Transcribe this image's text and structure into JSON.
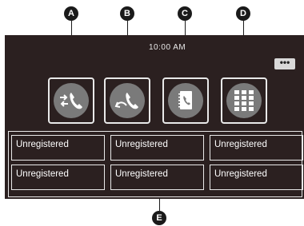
{
  "callouts": {
    "a": "A",
    "b": "B",
    "c": "C",
    "d": "D",
    "e": "E"
  },
  "status": {
    "time": "10:00 AM"
  },
  "more_button": {
    "label": "•••"
  },
  "icons": [
    "call-transfer-icon",
    "call-forward-icon",
    "phonebook-icon",
    "keypad-icon"
  ],
  "slots": [
    {
      "label": "Unregistered"
    },
    {
      "label": "Unregistered"
    },
    {
      "label": "Unregistered"
    },
    {
      "label": "Unregistered"
    },
    {
      "label": "Unregistered"
    },
    {
      "label": "Unregistered"
    }
  ],
  "colors": {
    "screen_bg": "#2b2020",
    "icon_circle": "#7a7a7a",
    "border": "#e9e9e9"
  }
}
